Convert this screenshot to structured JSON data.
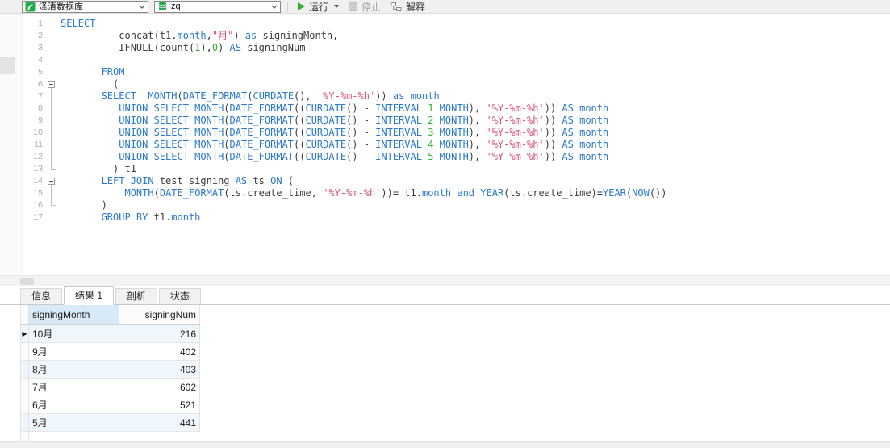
{
  "colors": {
    "keyword": "#2878cc",
    "string": "#e0506e",
    "number": "#32b232",
    "plain": "#3c3c3c",
    "accent_green": "#22ac46"
  },
  "toolbar": {
    "database_select": {
      "value": "泽清数据库"
    },
    "connection_select": {
      "value": "zq"
    },
    "run_label": "运行",
    "stop_label": "停止",
    "explain_label": "解释"
  },
  "editor": {
    "lines": [
      {
        "num": 1,
        "segments": [
          {
            "t": "SELECT",
            "c": "kw"
          }
        ]
      },
      {
        "num": 2,
        "segments": [
          {
            "t": "          concat(t1.",
            "c": "pl"
          },
          {
            "t": "month",
            "c": "kw"
          },
          {
            "t": ",",
            "c": "pl"
          },
          {
            "t": "\"月\"",
            "c": "str"
          },
          {
            "t": ") ",
            "c": "pl"
          },
          {
            "t": "as",
            "c": "kw"
          },
          {
            "t": " signingMonth,",
            "c": "pl"
          }
        ]
      },
      {
        "num": 3,
        "segments": [
          {
            "t": "          IFNULL(count(",
            "c": "pl"
          },
          {
            "t": "1",
            "c": "num"
          },
          {
            "t": "),",
            "c": "pl"
          },
          {
            "t": "0",
            "c": "num"
          },
          {
            "t": ") ",
            "c": "pl"
          },
          {
            "t": "AS",
            "c": "kw"
          },
          {
            "t": " signingNum",
            "c": "pl"
          }
        ]
      },
      {
        "num": 4,
        "segments": []
      },
      {
        "num": 5,
        "segments": [
          {
            "t": "       ",
            "c": "pl"
          },
          {
            "t": "FROM",
            "c": "kw"
          }
        ]
      },
      {
        "num": 6,
        "fold": "open",
        "segments": [
          {
            "t": "         (",
            "c": "pl"
          }
        ]
      },
      {
        "num": 7,
        "fold": "line",
        "segments": [
          {
            "t": "       ",
            "c": "pl"
          },
          {
            "t": "SELECT",
            "c": "kw"
          },
          {
            "t": "  ",
            "c": "pl"
          },
          {
            "t": "MONTH",
            "c": "kw"
          },
          {
            "t": "(",
            "c": "pl"
          },
          {
            "t": "DATE_FORMAT",
            "c": "kw"
          },
          {
            "t": "(",
            "c": "pl"
          },
          {
            "t": "CURDATE",
            "c": "kw"
          },
          {
            "t": "(), ",
            "c": "pl"
          },
          {
            "t": "'%Y-%m-%h'",
            "c": "str"
          },
          {
            "t": ")) ",
            "c": "pl"
          },
          {
            "t": "as",
            "c": "kw"
          },
          {
            "t": " ",
            "c": "pl"
          },
          {
            "t": "month",
            "c": "kw"
          }
        ]
      },
      {
        "num": 8,
        "fold": "line",
        "segments": [
          {
            "t": "          ",
            "c": "pl"
          },
          {
            "t": "UNION SELECT MONTH",
            "c": "kw"
          },
          {
            "t": "(",
            "c": "pl"
          },
          {
            "t": "DATE_FORMAT",
            "c": "kw"
          },
          {
            "t": "((",
            "c": "pl"
          },
          {
            "t": "CURDATE",
            "c": "kw"
          },
          {
            "t": "() - ",
            "c": "pl"
          },
          {
            "t": "INTERVAL",
            "c": "kw"
          },
          {
            "t": " ",
            "c": "pl"
          },
          {
            "t": "1",
            "c": "num"
          },
          {
            "t": " ",
            "c": "pl"
          },
          {
            "t": "MONTH",
            "c": "kw"
          },
          {
            "t": "), ",
            "c": "pl"
          },
          {
            "t": "'%Y-%m-%h'",
            "c": "str"
          },
          {
            "t": ")) ",
            "c": "pl"
          },
          {
            "t": "AS",
            "c": "kw"
          },
          {
            "t": " ",
            "c": "pl"
          },
          {
            "t": "month",
            "c": "kw"
          }
        ]
      },
      {
        "num": 9,
        "fold": "line",
        "segments": [
          {
            "t": "          ",
            "c": "pl"
          },
          {
            "t": "UNION SELECT MONTH",
            "c": "kw"
          },
          {
            "t": "(",
            "c": "pl"
          },
          {
            "t": "DATE_FORMAT",
            "c": "kw"
          },
          {
            "t": "((",
            "c": "pl"
          },
          {
            "t": "CURDATE",
            "c": "kw"
          },
          {
            "t": "() - ",
            "c": "pl"
          },
          {
            "t": "INTERVAL",
            "c": "kw"
          },
          {
            "t": " ",
            "c": "pl"
          },
          {
            "t": "2",
            "c": "num"
          },
          {
            "t": " ",
            "c": "pl"
          },
          {
            "t": "MONTH",
            "c": "kw"
          },
          {
            "t": "), ",
            "c": "pl"
          },
          {
            "t": "'%Y-%m-%h'",
            "c": "str"
          },
          {
            "t": ")) ",
            "c": "pl"
          },
          {
            "t": "AS",
            "c": "kw"
          },
          {
            "t": " ",
            "c": "pl"
          },
          {
            "t": "month",
            "c": "kw"
          }
        ]
      },
      {
        "num": 10,
        "fold": "line",
        "segments": [
          {
            "t": "          ",
            "c": "pl"
          },
          {
            "t": "UNION SELECT MONTH",
            "c": "kw"
          },
          {
            "t": "(",
            "c": "pl"
          },
          {
            "t": "DATE_FORMAT",
            "c": "kw"
          },
          {
            "t": "((",
            "c": "pl"
          },
          {
            "t": "CURDATE",
            "c": "kw"
          },
          {
            "t": "() - ",
            "c": "pl"
          },
          {
            "t": "INTERVAL",
            "c": "kw"
          },
          {
            "t": " ",
            "c": "pl"
          },
          {
            "t": "3",
            "c": "num"
          },
          {
            "t": " ",
            "c": "pl"
          },
          {
            "t": "MONTH",
            "c": "kw"
          },
          {
            "t": "), ",
            "c": "pl"
          },
          {
            "t": "'%Y-%m-%h'",
            "c": "str"
          },
          {
            "t": ")) ",
            "c": "pl"
          },
          {
            "t": "AS",
            "c": "kw"
          },
          {
            "t": " ",
            "c": "pl"
          },
          {
            "t": "month",
            "c": "kw"
          }
        ]
      },
      {
        "num": 11,
        "fold": "line",
        "segments": [
          {
            "t": "          ",
            "c": "pl"
          },
          {
            "t": "UNION SELECT MONTH",
            "c": "kw"
          },
          {
            "t": "(",
            "c": "pl"
          },
          {
            "t": "DATE_FORMAT",
            "c": "kw"
          },
          {
            "t": "((",
            "c": "pl"
          },
          {
            "t": "CURDATE",
            "c": "kw"
          },
          {
            "t": "() - ",
            "c": "pl"
          },
          {
            "t": "INTERVAL",
            "c": "kw"
          },
          {
            "t": " ",
            "c": "pl"
          },
          {
            "t": "4",
            "c": "num"
          },
          {
            "t": " ",
            "c": "pl"
          },
          {
            "t": "MONTH",
            "c": "kw"
          },
          {
            "t": "), ",
            "c": "pl"
          },
          {
            "t": "'%Y-%m-%h'",
            "c": "str"
          },
          {
            "t": ")) ",
            "c": "pl"
          },
          {
            "t": "AS",
            "c": "kw"
          },
          {
            "t": " ",
            "c": "pl"
          },
          {
            "t": "month",
            "c": "kw"
          }
        ]
      },
      {
        "num": 12,
        "fold": "line",
        "segments": [
          {
            "t": "          ",
            "c": "pl"
          },
          {
            "t": "UNION SELECT MONTH",
            "c": "kw"
          },
          {
            "t": "(",
            "c": "pl"
          },
          {
            "t": "DATE_FORMAT",
            "c": "kw"
          },
          {
            "t": "((",
            "c": "pl"
          },
          {
            "t": "CURDATE",
            "c": "kw"
          },
          {
            "t": "() - ",
            "c": "pl"
          },
          {
            "t": "INTERVAL",
            "c": "kw"
          },
          {
            "t": " ",
            "c": "pl"
          },
          {
            "t": "5",
            "c": "num"
          },
          {
            "t": " ",
            "c": "pl"
          },
          {
            "t": "MONTH",
            "c": "kw"
          },
          {
            "t": "), ",
            "c": "pl"
          },
          {
            "t": "'%Y-%m-%h'",
            "c": "str"
          },
          {
            "t": ")) ",
            "c": "pl"
          },
          {
            "t": "AS",
            "c": "kw"
          },
          {
            "t": " ",
            "c": "pl"
          },
          {
            "t": "month",
            "c": "kw"
          }
        ]
      },
      {
        "num": 13,
        "fold": "end",
        "segments": [
          {
            "t": "         ) t1",
            "c": "pl"
          }
        ]
      },
      {
        "num": 14,
        "fold": "open",
        "segments": [
          {
            "t": "       ",
            "c": "pl"
          },
          {
            "t": "LEFT JOIN",
            "c": "kw"
          },
          {
            "t": " test_signing ",
            "c": "pl"
          },
          {
            "t": "AS",
            "c": "kw"
          },
          {
            "t": " ts ",
            "c": "pl"
          },
          {
            "t": "ON",
            "c": "kw"
          },
          {
            "t": " (",
            "c": "pl"
          }
        ]
      },
      {
        "num": 15,
        "fold": "line",
        "segments": [
          {
            "t": "           ",
            "c": "pl"
          },
          {
            "t": "MONTH",
            "c": "kw"
          },
          {
            "t": "(",
            "c": "pl"
          },
          {
            "t": "DATE_FORMAT",
            "c": "kw"
          },
          {
            "t": "(ts.create_time, ",
            "c": "pl"
          },
          {
            "t": "'%Y-%m-%h'",
            "c": "str"
          },
          {
            "t": "))= t1.",
            "c": "pl"
          },
          {
            "t": "month",
            "c": "kw"
          },
          {
            "t": " ",
            "c": "pl"
          },
          {
            "t": "and",
            "c": "kw"
          },
          {
            "t": " ",
            "c": "pl"
          },
          {
            "t": "YEAR",
            "c": "kw"
          },
          {
            "t": "(ts.create_time)=",
            "c": "pl"
          },
          {
            "t": "YEAR",
            "c": "kw"
          },
          {
            "t": "(",
            "c": "pl"
          },
          {
            "t": "NOW",
            "c": "kw"
          },
          {
            "t": "())",
            "c": "pl"
          }
        ]
      },
      {
        "num": 16,
        "fold": "end",
        "segments": [
          {
            "t": "       )",
            "c": "pl"
          }
        ]
      },
      {
        "num": 17,
        "segments": [
          {
            "t": "       ",
            "c": "pl"
          },
          {
            "t": "GROUP BY",
            "c": "kw"
          },
          {
            "t": " t1.",
            "c": "pl"
          },
          {
            "t": "month",
            "c": "kw"
          }
        ]
      }
    ]
  },
  "results": {
    "tabs": [
      {
        "label": "信息",
        "active": false
      },
      {
        "label": "结果 1",
        "active": true
      },
      {
        "label": "剖析",
        "active": false
      },
      {
        "label": "状态",
        "active": false
      }
    ],
    "grid": {
      "current_row_marker": "▶",
      "columns": [
        {
          "label": "signingMonth",
          "selected": true
        },
        {
          "label": "signingNum",
          "selected": false
        }
      ],
      "rows": [
        {
          "signingMonth": "10月",
          "signingNum": "216",
          "tinted": true,
          "current": true
        },
        {
          "signingMonth": "9月",
          "signingNum": "402",
          "tinted": false,
          "current": false
        },
        {
          "signingMonth": "8月",
          "signingNum": "403",
          "tinted": true,
          "current": false
        },
        {
          "signingMonth": "7月",
          "signingNum": "602",
          "tinted": false,
          "current": false
        },
        {
          "signingMonth": "6月",
          "signingNum": "521",
          "tinted": false,
          "current": false
        },
        {
          "signingMonth": "5月",
          "signingNum": "441",
          "tinted": true,
          "current": false
        }
      ]
    }
  }
}
